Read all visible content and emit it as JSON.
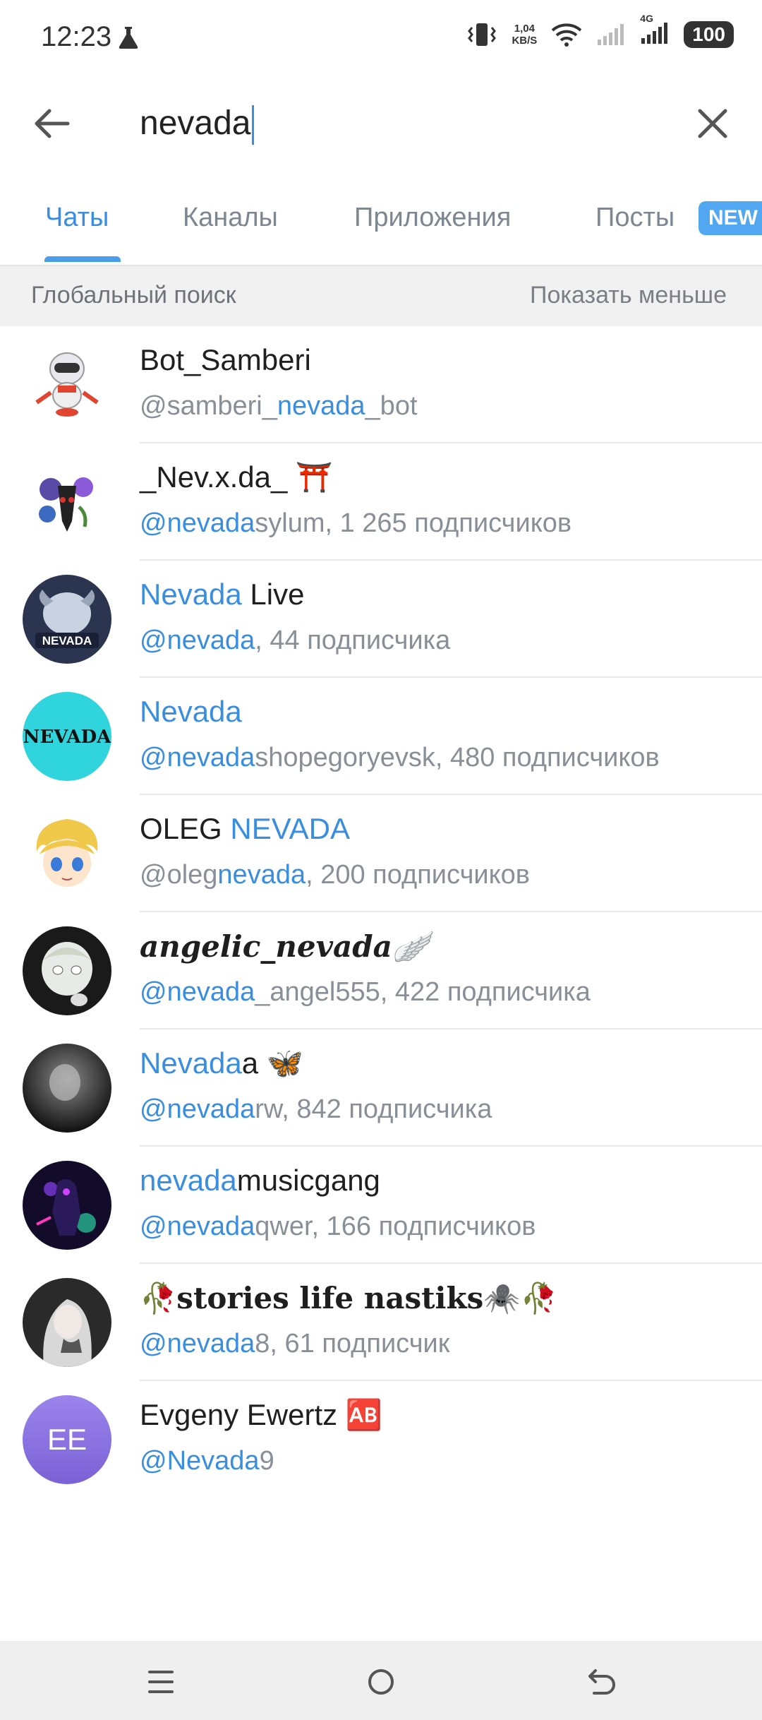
{
  "status_bar": {
    "time": "12:23",
    "speed_top": "1,04",
    "speed_bottom": "KB/S",
    "network_type": "4G",
    "battery": "100",
    "icons": [
      "flask-icon",
      "vibrate-icon",
      "wifi-icon",
      "signal-icon",
      "signal-icon",
      "battery-icon"
    ]
  },
  "search": {
    "query": "nevada",
    "back_icon": "arrow-left-icon",
    "clear_icon": "close-icon"
  },
  "tabs": [
    {
      "label": "Чаты",
      "active": true
    },
    {
      "label": "Каналы",
      "active": false
    },
    {
      "label": "Приложения",
      "active": false
    },
    {
      "label": "Посты",
      "active": false,
      "badge": "NEW"
    }
  ],
  "global_search": {
    "title": "Глобальный поиск",
    "action": "Показать меньше"
  },
  "results": [
    {
      "name_plain_pre": "Bot_Samberi",
      "name_hl": "",
      "name_plain_post": "",
      "sub_pre": "@samberi_",
      "sub_hl": "nevada",
      "sub_post": "_bot",
      "avatar": "robot"
    },
    {
      "name_plain_pre": "_Nev.x.da_ ⛩️",
      "name_hl": "",
      "name_plain_post": "",
      "sub_pre": "@",
      "sub_hl": "nevada",
      "sub_post": "sylum, 1 265 подписчиков",
      "sub_pre_highlight": true,
      "avatar": "flowers"
    },
    {
      "name_plain_pre": "",
      "name_hl": "Nevada",
      "name_plain_post": " Live",
      "sub_pre": "@",
      "sub_hl": "nevada",
      "sub_post": ", 44 подписчика",
      "sub_pre_highlight": true,
      "avatar": "ram"
    },
    {
      "name_plain_pre": "",
      "name_hl": "Nevada",
      "name_plain_post": "",
      "sub_pre": "@",
      "sub_hl": "nevada",
      "sub_post": "shopegoryevsk, 480 подписчиков",
      "sub_pre_highlight": true,
      "avatar": "nevada-logo",
      "avatar_text": "NEVADA"
    },
    {
      "name_plain_pre": "OLEG ",
      "name_hl": "NEVADA",
      "name_plain_post": "",
      "sub_pre": "@oleg",
      "sub_hl": "nevada",
      "sub_post": ", 200 подписчиков",
      "avatar": "anime-boy"
    },
    {
      "name_plain_pre": "angelic_nevada🪽",
      "name_hl": "",
      "name_plain_post": "",
      "sub_pre": "@",
      "sub_hl": "nevada",
      "sub_post": "_angel555, 422 подписчика",
      "sub_pre_highlight": true,
      "avatar": "angel-doll",
      "script": true
    },
    {
      "name_plain_pre": "",
      "name_hl": "Nevada",
      "name_plain_post": "a 🦋",
      "sub_pre": "@",
      "sub_hl": "nevada",
      "sub_post": "rw, 842 подписчика",
      "sub_pre_highlight": true,
      "avatar": "dark-photo"
    },
    {
      "name_plain_pre": "",
      "name_hl": "nevada",
      "name_plain_post": "musicgang",
      "sub_pre": "@",
      "sub_hl": "nevada",
      "sub_post": "qwer, 166 подписчиков",
      "sub_pre_highlight": true,
      "avatar": "neon-figure"
    },
    {
      "name_plain_pre": "🥀stories life nastiks🕷️🥀",
      "name_hl": "",
      "name_plain_post": "",
      "sub_pre": "@",
      "sub_hl": "nevada",
      "sub_post": "8, 61 подписчик",
      "sub_pre_highlight": true,
      "avatar": "girl-photo",
      "serif": true
    },
    {
      "name_plain_pre": "Evgeny Ewertz 🆎",
      "name_hl": "",
      "name_plain_post": "",
      "sub_pre": "@",
      "sub_hl": "Nevada",
      "sub_post": "9",
      "sub_pre_highlight": true,
      "avatar": "initials",
      "avatar_text": "EE"
    }
  ],
  "nav_bar": {
    "icons": [
      "menu-icon",
      "home-circle-icon",
      "back-icon"
    ]
  },
  "colors": {
    "accent": "#3a8ee0",
    "badge": "#52a8f0",
    "initials_avatar": "#8a72e0",
    "nevada_logo_bg": "#2fd4dc"
  }
}
